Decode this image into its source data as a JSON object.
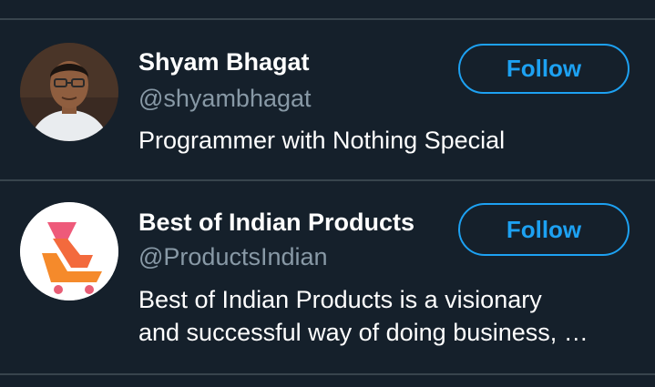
{
  "follow_suggestions": [
    {
      "name": "Shyam Bhagat",
      "handle": "@shyambhagat",
      "bio_lines": [
        "Programmer with Nothing Special"
      ],
      "follow_label": "Follow",
      "avatar": "profile-photo"
    },
    {
      "name": "Best of Indian Products",
      "handle": "@ProductsIndian",
      "bio_lines": [
        "Best of Indian Products is a visionary",
        "and successful way of doing business, …"
      ],
      "follow_label": "Follow",
      "avatar": "orange-cart-logo"
    }
  ],
  "colors": {
    "background": "#15202b",
    "divider": "#38444d",
    "accent": "#1da1f2",
    "text_primary": "#ffffff",
    "text_secondary": "#8899a6"
  }
}
